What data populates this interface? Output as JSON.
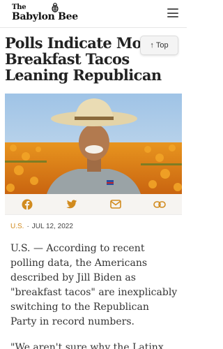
{
  "header": {
    "logo_line1": "The",
    "logo_line2": "Babylon Bee"
  },
  "article": {
    "title": "Polls Indicate More Breakfast Tacos Leaning Republican",
    "category": "U.S.",
    "separator": "·",
    "date": "JUL 12, 2022",
    "paragraphs": [
      "U.S. — According to recent polling data, the Americans described by Jill Biden as \"breakfast tacos\" are inexplicably switching to the Republican Party in record numbers.",
      "\"We aren't sure why the Latinx,"
    ]
  },
  "top_button": {
    "label": "Top"
  },
  "share": {
    "icons": [
      "facebook-icon",
      "twitter-icon",
      "email-icon",
      "link-icon"
    ]
  },
  "colors": {
    "accent": "#d18b1f",
    "share_icon": "#d18b1f",
    "share_bar_bg": "#f6f4f1"
  }
}
